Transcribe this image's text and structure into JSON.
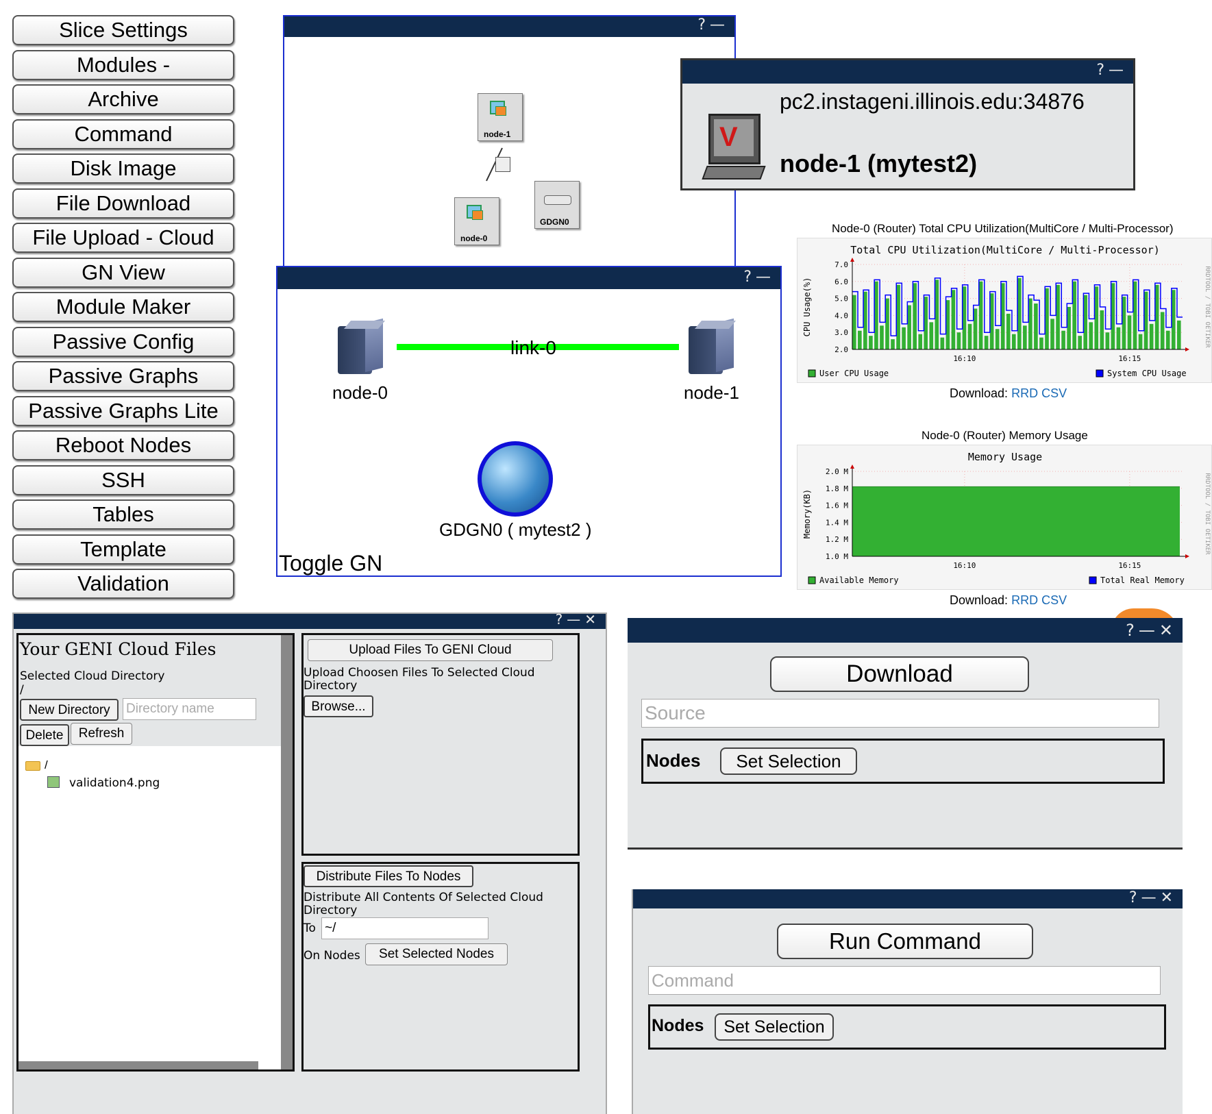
{
  "menu": {
    "items": [
      "Slice Settings",
      "Modules -",
      "Archive",
      "Command",
      "Disk Image",
      "File Download",
      "File Upload - Cloud",
      "GN View",
      "Module Maker",
      "Passive Config",
      "Passive Graphs",
      "Passive Graphs Lite",
      "Reboot Nodes",
      "SSH",
      "Tables",
      "Template",
      "Validation"
    ]
  },
  "titlebar": {
    "help": "?",
    "minimize": "—",
    "close": "✕"
  },
  "topology": {
    "node1_label": "node-1",
    "node0_label": "node-0",
    "gdgn_label": "GDGN0"
  },
  "node_info": {
    "host": "pc2.instageni.illinois.edu:34876",
    "name": "node-1 (mytest2)"
  },
  "gn_view": {
    "link_label": "link-0",
    "node0_label": "node-0",
    "node1_label": "node-1",
    "gn_label": "GDGN0 ( mytest2 )",
    "toggle_label": "Toggle GN"
  },
  "cpu_graph": {
    "caption": "Node-0 (Router) Total CPU Utilization(MultiCore / Multi-Processor)",
    "download_label": "Download:",
    "download_link": "RRD CSV",
    "side_text": "RRDTOOL / TOBI OETIKER",
    "chart_data": {
      "type": "bar",
      "title": "Total CPU Utilization(MultiCore / Multi-Processor)",
      "ylabel": "CPU Usage(%)",
      "ylim": [
        2.0,
        7.0
      ],
      "yticks": [
        "7.0",
        "6.0",
        "5.0",
        "4.0",
        "3.0",
        "2.0"
      ],
      "xticks": [
        "16:10",
        "16:15"
      ],
      "legend": [
        "User CPU Usage",
        "System CPU Usage"
      ],
      "colors": {
        "user": "#33b033",
        "system": "#0000ff"
      },
      "series": [
        {
          "name": "User CPU Usage",
          "values": [
            5.2,
            3.1,
            5.4,
            2.8,
            6.0,
            3.4,
            5.0,
            2.6,
            5.8,
            3.3,
            4.6,
            5.9,
            2.9,
            5.1,
            3.6,
            6.1,
            2.7,
            4.9,
            5.5,
            3.0,
            5.7,
            3.5,
            4.4,
            6.0,
            2.8,
            5.3,
            3.2,
            5.9,
            4.1,
            2.9,
            6.2,
            3.4,
            5.0,
            4.7,
            2.7,
            5.6,
            3.8,
            5.8,
            3.1,
            4.5,
            6.0,
            2.8,
            5.2,
            3.6,
            5.7,
            4.3,
            3.0,
            5.9,
            3.3,
            5.1,
            4.0,
            6.0,
            2.9,
            5.4,
            3.5,
            5.8,
            4.2,
            3.1,
            5.5,
            3.7
          ]
        },
        {
          "name": "System CPU Usage",
          "values": [
            5.4,
            3.3,
            5.5,
            3.0,
            6.1,
            3.6,
            5.2,
            2.8,
            5.9,
            3.5,
            4.8,
            6.0,
            3.1,
            5.2,
            3.8,
            6.2,
            2.9,
            5.1,
            5.6,
            3.2,
            5.8,
            3.7,
            4.6,
            6.1,
            3.0,
            5.4,
            3.4,
            6.0,
            4.3,
            3.1,
            6.3,
            3.6,
            5.2,
            4.9,
            2.9,
            5.7,
            4.0,
            5.9,
            3.3,
            4.7,
            6.1,
            3.0,
            5.3,
            3.8,
            5.8,
            4.5,
            3.2,
            6.0,
            3.5,
            5.2,
            4.2,
            6.1,
            3.1,
            5.5,
            3.7,
            5.9,
            4.4,
            3.3,
            5.6,
            3.9
          ]
        }
      ]
    }
  },
  "mem_graph": {
    "caption": "Node-0 (Router) Memory Usage",
    "download_label": "Download:",
    "download_link": "RRD CSV",
    "side_text": "RRDTOOL / TOBI OETIKER",
    "chart_data": {
      "type": "area",
      "title": "Memory Usage",
      "ylabel": "Memory(KB)",
      "ylim": [
        1.0,
        2.0
      ],
      "yticks": [
        "2.0 M",
        "1.8 M",
        "1.6 M",
        "1.4 M",
        "1.2 M",
        "1.0 M"
      ],
      "xticks": [
        "16:10",
        "16:15"
      ],
      "legend": [
        "Available Memory",
        "Total Real Memory"
      ],
      "colors": {
        "available": "#33b033",
        "total": "#0000ff"
      },
      "series": [
        {
          "name": "Available Memory",
          "values": [
            1.82,
            1.82
          ]
        },
        {
          "name": "Total Real Memory",
          "values": [
            1.0,
            1.0
          ]
        }
      ]
    }
  },
  "cloud": {
    "heading": "Your GENI Cloud Files",
    "selected_dir_label": "Selected Cloud Directory",
    "selected_dir": "/",
    "new_dir_button": "New Directory",
    "dir_placeholder": "Directory name",
    "delete_button": "Delete",
    "refresh_button": "Refresh",
    "tree_root": "/",
    "tree_file": "validation4.png",
    "upload_button": "Upload Files To GENI Cloud",
    "upload_desc": "Upload Choosen Files To Selected Cloud Directory",
    "browse_button": "Browse...",
    "distribute_button": "Distribute Files To Nodes",
    "distribute_desc": "Distribute All Contents Of Selected Cloud Directory",
    "to_label": "To",
    "to_value": "~/",
    "on_nodes_label": "On Nodes",
    "set_nodes_button": "Set Selected Nodes"
  },
  "download": {
    "button": "Download",
    "source_placeholder": "Source",
    "nodes_label": "Nodes",
    "set_selection": "Set Selection"
  },
  "command": {
    "button": "Run Command",
    "command_placeholder": "Command",
    "nodes_label": "Nodes",
    "set_selection": "Set Selection"
  }
}
